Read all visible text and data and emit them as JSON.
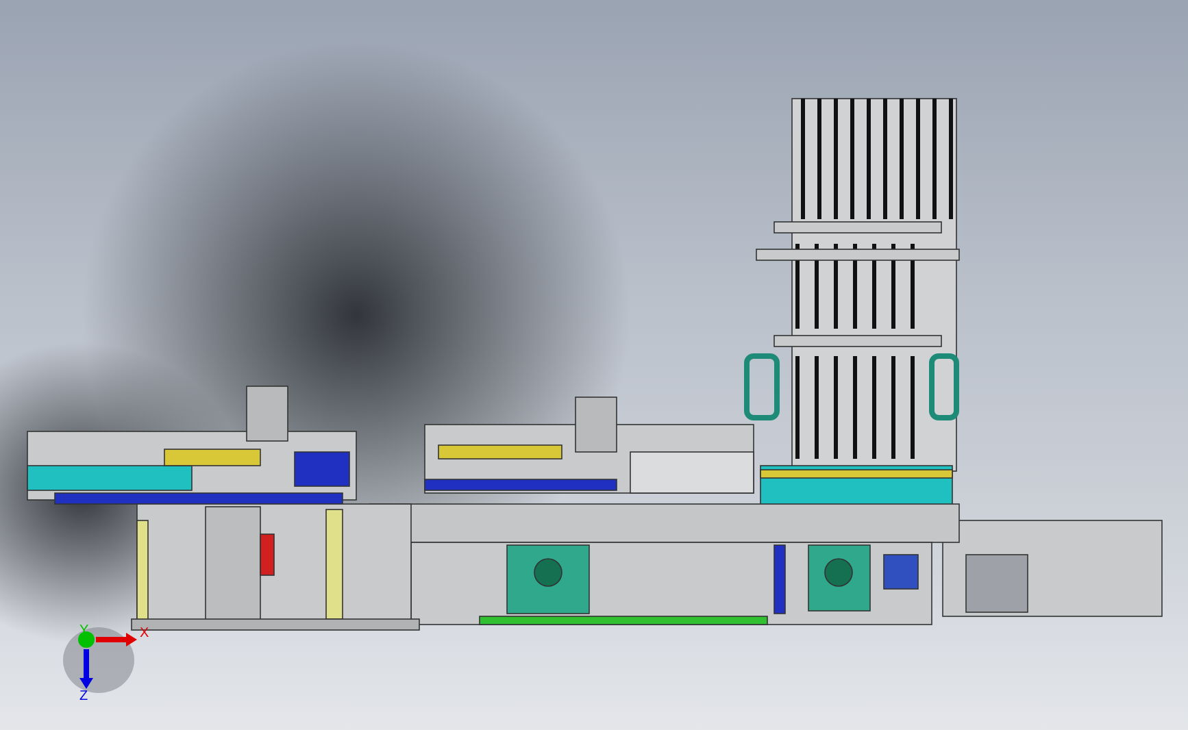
{
  "viewport": {
    "triad": {
      "axes": [
        {
          "label": "X",
          "color": "#e00000"
        },
        {
          "label": "Y",
          "color": "#00c000"
        },
        {
          "label": "Z",
          "color": "#0000e0"
        }
      ]
    }
  }
}
